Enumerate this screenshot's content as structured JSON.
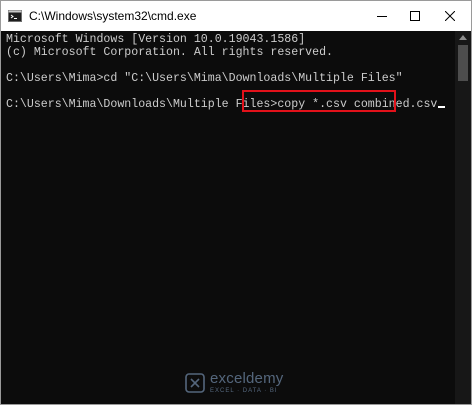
{
  "window": {
    "title": "C:\\Windows\\system32\\cmd.exe",
    "icon": "cmd-icon"
  },
  "caption_buttons": {
    "minimize_icon": "minimize-icon",
    "maximize_icon": "maximize-icon",
    "close_icon": "close-icon"
  },
  "console": {
    "lines": [
      "Microsoft Windows [Version 10.0.19043.1586]",
      "(c) Microsoft Corporation. All rights reserved.",
      "C:\\Users\\Mima>cd \"C:\\Users\\Mima\\Downloads\\Multiple Files\""
    ],
    "prompt": "C:\\Users\\Mima\\Downloads\\Multiple Files>",
    "current_command": "copy *.csv combined.csv"
  },
  "colors": {
    "console_bg": "#0c0c0c",
    "console_text": "#cccccc",
    "highlight_border": "#e3111a"
  },
  "watermark": {
    "name": "exceldemy",
    "tagline": "EXCEL · DATA · BI"
  }
}
